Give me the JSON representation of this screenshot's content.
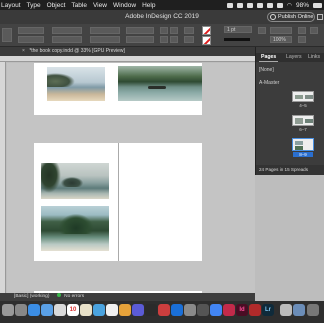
{
  "menubar": {
    "items": [
      "Layout",
      "Type",
      "Object",
      "Table",
      "View",
      "Window",
      "Help"
    ],
    "battery": "98%",
    "wifi_icon": "wifi-icon"
  },
  "app": {
    "title": "Adobe InDesign CC 2019",
    "publish_label": "Publish Online"
  },
  "control": {
    "stroke_weight": "1 pt",
    "zoom": "100%",
    "auto_fit": "Auto-Fit"
  },
  "document_tab": {
    "label": "*the book copy.indd @ 33% [GPU Preview]"
  },
  "pages_panel": {
    "tabs": [
      "Pages",
      "Layers",
      "Links"
    ],
    "none_label": "[None]",
    "master_label": "A-Master",
    "pages": [
      {
        "label": "4–5",
        "selected": false
      },
      {
        "label": "6–7",
        "selected": false
      },
      {
        "label": "8–9",
        "selected": true
      }
    ],
    "footer": "24 Pages in 15 Spreads"
  },
  "status": {
    "style": "[Basic] (working)",
    "preflight": "No errors"
  },
  "dock": {
    "calendar_day": "10",
    "id_label": "Id",
    "lr_label": "Lr"
  },
  "colors": {
    "accent": "#2a6fd0",
    "preflight_ok": "#39b54a"
  }
}
